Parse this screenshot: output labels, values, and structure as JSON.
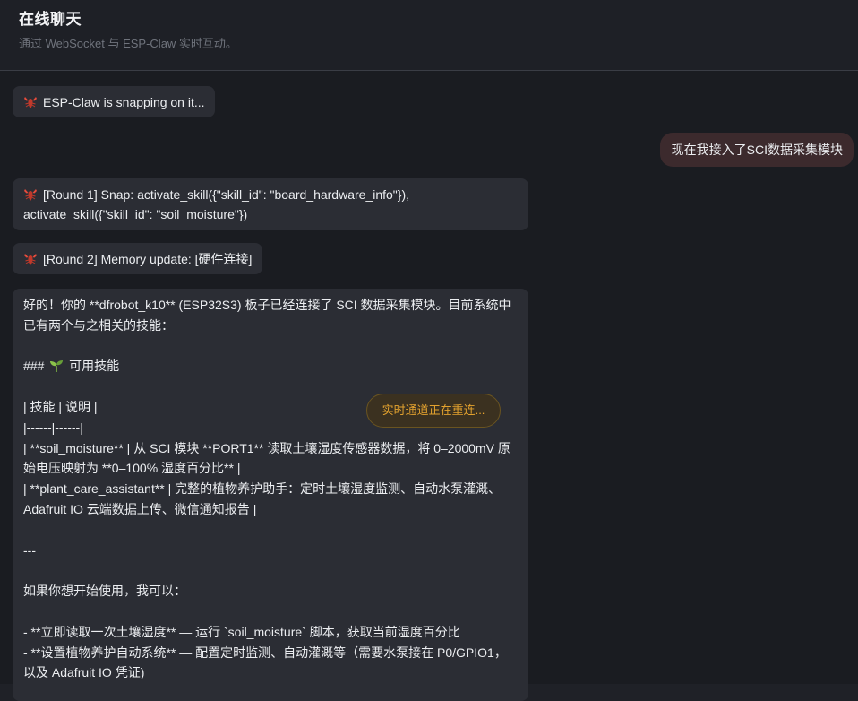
{
  "header": {
    "title": "在线聊天",
    "subtitle": "通过 WebSocket 与 ESP-Claw 实时互动。"
  },
  "messages": {
    "status": "ESP-Claw is snapping on it...",
    "user": "现在我接入了SCI数据采集模块",
    "round1": "[Round 1] Snap: activate_skill({\"skill_id\": \"board_hardware_info\"}), activate_skill({\"skill_id\": \"soil_moisture\"})",
    "round2": "[Round 2] Memory update: [硬件连接]",
    "answer": {
      "l1": "好的！你的 **dfrobot_k10** (ESP32S3) 板子已经连接了 SCI 数据采集模块。目前系统中已有两个与之相关的技能：",
      "l2": "",
      "l3a": "###",
      "l3b": "可用技能",
      "l4": "",
      "l5": "| 技能 | 说明 |",
      "l6": "|------|------|",
      "l7": "| **soil_moisture** | 从 SCI 模块 **PORT1** 读取土壤湿度传感器数据，将 0–2000mV 原始电压映射为 **0–100% 湿度百分比** |",
      "l8": "| **plant_care_assistant** | 完整的植物养护助手：定时土壤湿度监测、自动水泵灌溉、Adafruit IO 云端数据上传、微信通知报告 |",
      "l9": "",
      "l10": "---",
      "l11": "",
      "l12": "如果你想开始使用，我可以：",
      "l13": "",
      "l14": "- **立即读取一次土壤湿度** — 运行 `soil_moisture` 脚本，获取当前湿度百分比",
      "l15": "- **设置植物养护自动系统** — 配置定时监测、自动灌溉等（需要水泵接在 P0/GPIO1，以及 Adafruit IO 凭证)"
    }
  },
  "toast": {
    "reconnecting": "实时通道正在重连..."
  },
  "icons": {
    "bot": "lobster-icon",
    "heading": "seedling-icon"
  },
  "colors": {
    "background": "#1a1c21",
    "bubble": "#2b2d34",
    "user_bubble": "#3c2a2d",
    "toast_text": "#e3a22e"
  }
}
